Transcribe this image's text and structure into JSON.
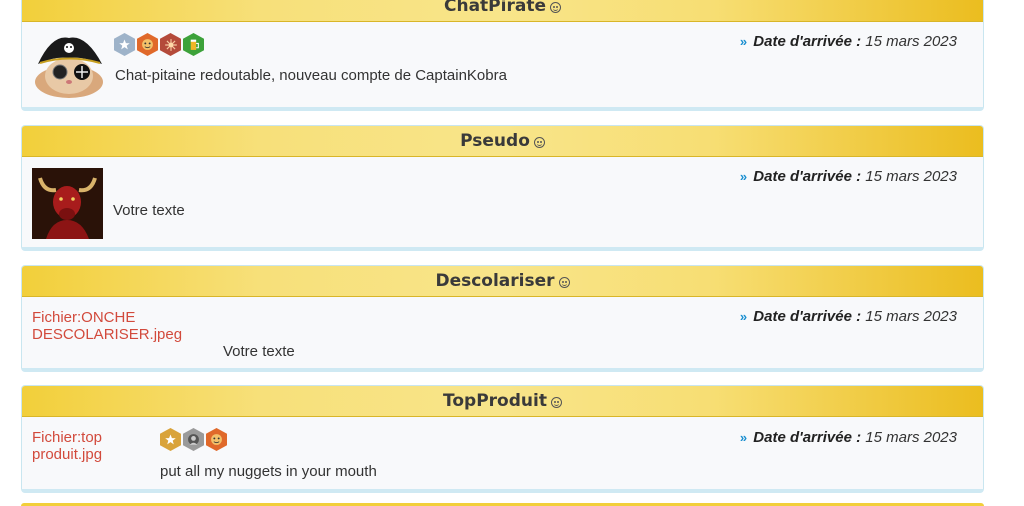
{
  "profiles": [
    {
      "name": "ChatPirate",
      "date_label": "Date d'arrivée :",
      "date_value": "15 mars 2023",
      "description": "Chat-pitaine redoutable, nouveau compte de CaptainKobra",
      "avatar": "pirate-cat-avatar",
      "badges": [
        "silver-star-badge",
        "orange-face-badge",
        "red-burst-badge",
        "green-beer-badge"
      ]
    },
    {
      "name": "Pseudo",
      "date_label": "Date d'arrivée :",
      "date_value": "15 mars 2023",
      "description": "Votre texte",
      "avatar": "red-bull-avatar"
    },
    {
      "name": "Descolariser",
      "date_label": "Date d'arrivée :",
      "date_value": "15 mars 2023",
      "description": "Votre texte",
      "file_link": "Fichier:ONCHE DESCOLARISER.jpeg"
    },
    {
      "name": "TopProduit",
      "date_label": "Date d'arrivée :",
      "date_value": "15 mars 2023",
      "description": "put all my nuggets in your mouth",
      "file_link": "Fichier:top produit.jpg",
      "badges": [
        "gold-star-badge",
        "grey-face-badge",
        "orange-face-badge"
      ]
    }
  ],
  "colors": {
    "header_gold": "#f2cf3a",
    "link_red": "#d24a3c",
    "chevron_blue": "#1a8fd0"
  }
}
